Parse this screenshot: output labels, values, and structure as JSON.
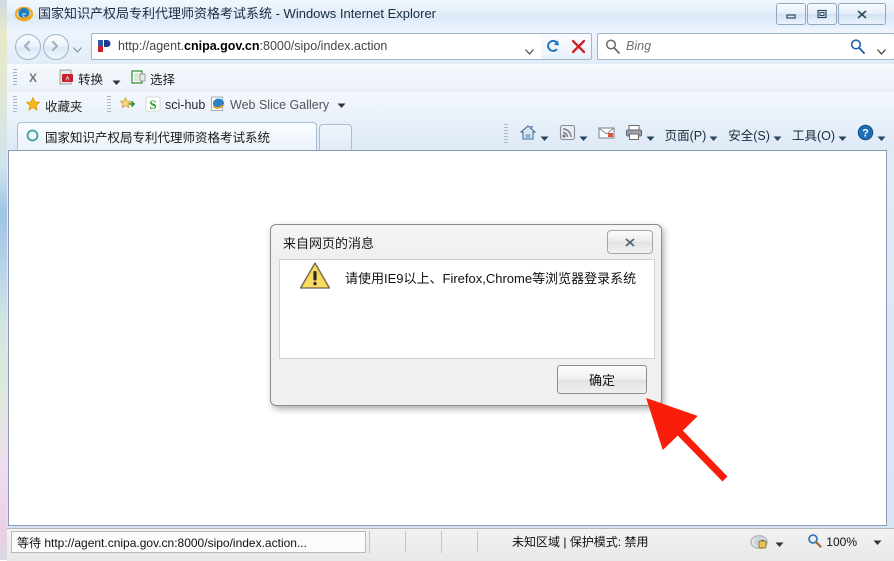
{
  "window": {
    "title": "国家知识产权局专利代理师资格考试系统 - Windows Internet Explorer",
    "minimize_label": "最小化",
    "restore_label": "向下还原",
    "close_label": "关闭"
  },
  "navigation": {
    "back_label": "后退",
    "forward_label": "前进",
    "history_label": "最近使用的页面",
    "address_value": "http://agent.cnipa.gov.cn:8000/sipo/index.action",
    "address_prefix": "http://agent.",
    "address_bold1": "cnipa.gov.cn",
    "address_suffix": ":8000/sipo/index.action",
    "refresh_label": "刷新",
    "stop_label": "停止",
    "search_placeholder": "Bing",
    "search_go_label": "搜索",
    "search_caret_label": "搜索选项"
  },
  "pdf_toolbar": {
    "close_label": "X",
    "convert_label": "转换",
    "select_label": "选择"
  },
  "favorites_bar": {
    "favorites_label": "收藏夹",
    "items": [
      {
        "label": "sci-hub",
        "icon": "sci-hub-icon"
      },
      {
        "label": "Web Slice Gallery",
        "icon": "web-slice-icon"
      }
    ]
  },
  "tabs": {
    "active_tab_label": "国家知识产权局专利代理师资格考试系统",
    "new_tab_label": "新选项卡"
  },
  "command_bar": {
    "home_label": "主页",
    "feeds_label": "源",
    "mail_label": "阅读邮件",
    "print_label": "打印",
    "items": [
      {
        "label": "页面(P)"
      },
      {
        "label": "安全(S)"
      },
      {
        "label": "工具(O)"
      }
    ],
    "help_label": "帮助"
  },
  "dialog": {
    "title": "来自网页的消息",
    "close_label": "关闭",
    "icon": "warning-icon",
    "message": "请使用IE9以上、Firefox,Chrome等浏览器登录系统",
    "ok_label": "确定"
  },
  "annotation": {
    "arrow_color": "#f91d0a",
    "arrow_label": "红色指示箭头"
  },
  "status_bar": {
    "loading_text": "等待 http://agent.cnipa.gov.cn:8000/sipo/index.action...",
    "zone_text": "未知区域 | 保护模式: 禁用",
    "zoom_level": "100%"
  },
  "colors": {
    "window_chrome": "#e2ecf8",
    "page_background": "#ffffff",
    "dialog_face": "#f0f0f0",
    "accent_red": "#f91d0a",
    "warning_yellow": "#f5c01a"
  }
}
